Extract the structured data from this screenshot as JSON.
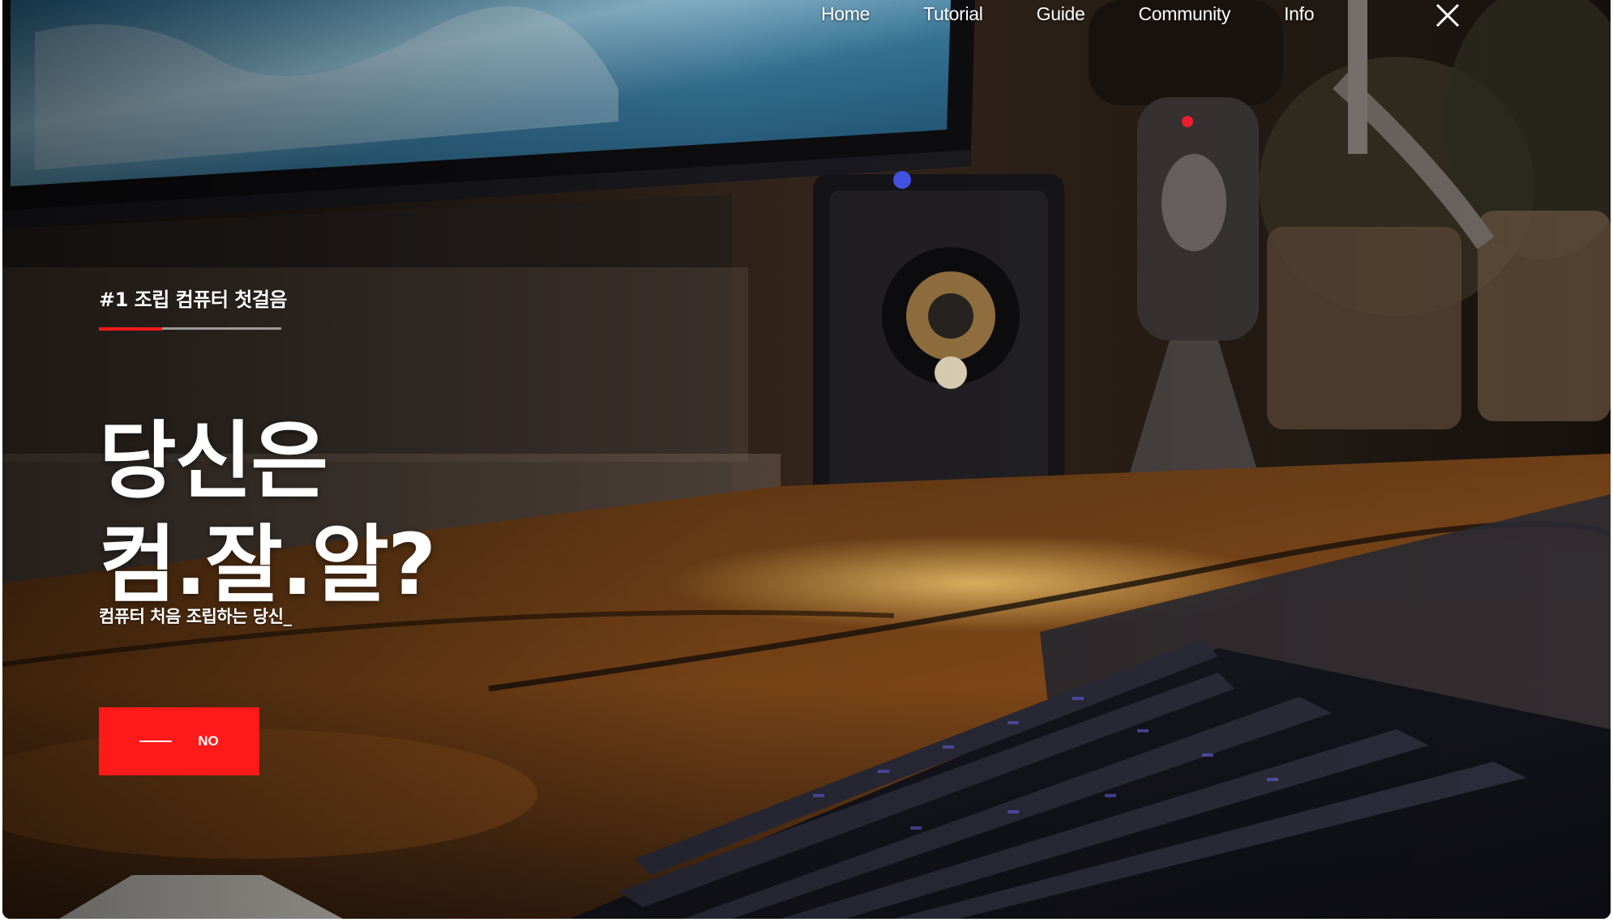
{
  "nav": {
    "items": [
      {
        "label": "Home"
      },
      {
        "label": "Tutorial"
      },
      {
        "label": "Guide"
      },
      {
        "label": "Community"
      },
      {
        "label": "Info"
      }
    ],
    "close_icon": "close-icon"
  },
  "hero": {
    "eyebrow": "#1 조립 컴퓨터 첫걸음",
    "headline_line1": "당신은",
    "headline_line2": "컴.잘.알?",
    "subtitle": "컴퓨터 처음 조립하는 당신_",
    "cta_label": "NO"
  },
  "colors": {
    "accent": "#ff1a1a",
    "text": "#ffffff"
  }
}
